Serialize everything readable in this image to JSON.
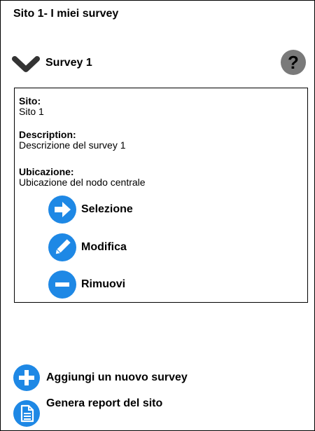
{
  "page": {
    "title": "Sito 1- I miei survey"
  },
  "survey": {
    "title": "Survey 1",
    "help_symbol": "?",
    "chevron_icon": "chevron-down-icon",
    "fields": {
      "site_label": "Sito:",
      "site_value": "Sito 1",
      "description_label": "Description:",
      "description_value": "Descrizione del survey 1",
      "location_label": "Ubicazione:",
      "location_value": "Ubicazione del nodo centrale"
    },
    "actions": {
      "select_label": "Selezione",
      "edit_label": "Modifica",
      "remove_label": "Rimuovi"
    }
  },
  "footer": {
    "add_label": "Aggiungi un nuovo survey",
    "report_label": "Genera report del sito"
  },
  "colors": {
    "accent": "#1e88e5",
    "help_bg": "#7a7a7a",
    "chevron": "#333333"
  }
}
